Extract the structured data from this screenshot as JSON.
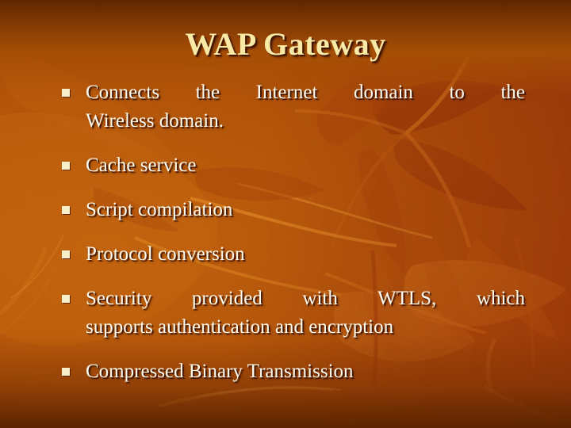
{
  "slide": {
    "title": "WAP Gateway",
    "theme": {
      "background_top": "#5E2700",
      "background_mid": "#B3560A",
      "background_bottom": "#5C2500",
      "leaf_dark": "#9E3F08",
      "leaf_light": "#D3791A",
      "leaf_gold": "#E4922A",
      "title_color": "#F8E9A6",
      "body_color": "#FFFDF2",
      "bullet_marker_color": "#F6EFC9",
      "text_shadow_color": "#3A1200"
    },
    "bullets": [
      {
        "marker": "square-bullet",
        "text": "Connects the Internet domain to the Wireless domain.",
        "line1": "Connects the Internet domain to the",
        "line2": "Wireless domain.",
        "wraps": true
      },
      {
        "marker": "square-bullet",
        "text": "Cache service",
        "line1": "Cache service",
        "line2": "",
        "wraps": false
      },
      {
        "marker": "square-bullet",
        "text": "Script compilation",
        "line1": "Script compilation",
        "line2": "",
        "wraps": false
      },
      {
        "marker": "square-bullet",
        "text": "Protocol conversion",
        "line1": "Protocol conversion",
        "line2": "",
        "wraps": false
      },
      {
        "marker": "square-bullet",
        "text": "Security provided with WTLS, which supports authentication and encryption",
        "line1": "Security provided with WTLS, which",
        "line2": "supports authentication and encryption",
        "wraps": true
      },
      {
        "marker": "square-bullet",
        "text": "Compressed Binary Transmission",
        "line1": "Compressed Binary Transmission",
        "line2": "",
        "wraps": false
      }
    ]
  }
}
